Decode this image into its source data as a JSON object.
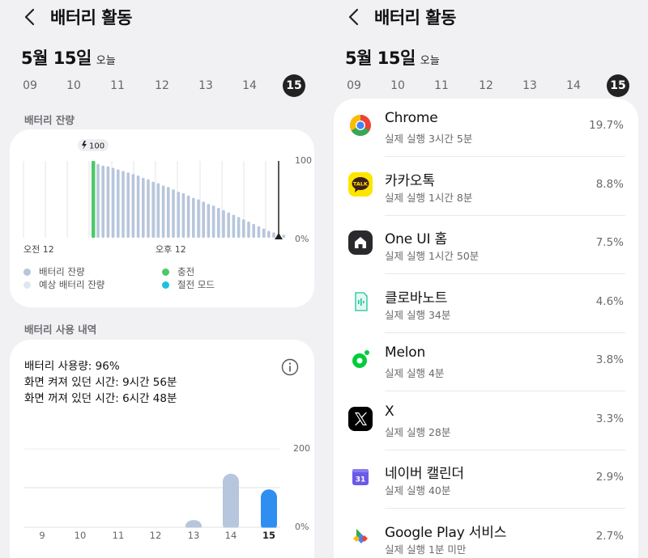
{
  "left": {
    "title": "배터리 활동",
    "date": "5월 15일",
    "date_sub": "오늘",
    "days": [
      "09",
      "10",
      "11",
      "12",
      "13",
      "14",
      "15"
    ],
    "selected_day": "15",
    "remaining_section": "배터리 잔량",
    "remaining_chart": {
      "charge_badge": "100",
      "y_top_label": "100",
      "y_bottom_label": "0%",
      "x_label_start": "오전 12",
      "x_label_mid": "오후 12",
      "levels": [
        100,
        96,
        94,
        93,
        91,
        89,
        87,
        85,
        83,
        81,
        78,
        76,
        73,
        71,
        68,
        66,
        63,
        60,
        58,
        55,
        52,
        50,
        47,
        44,
        42,
        39,
        36,
        33,
        30,
        27,
        24,
        21,
        18,
        15,
        12,
        9,
        7,
        5,
        4
      ],
      "colors": {
        "remaining": "#b7c6dc",
        "charging": "#4ec86a",
        "power_saving": "#1fc0e0",
        "estimated": "#dfe6ef"
      }
    },
    "legend": {
      "remaining": "배터리 잔량",
      "estimated": "예상 배터리 잔량",
      "charging": "충전",
      "power_saving": "절전 모드"
    },
    "usage_section": "배터리 사용 내역",
    "usage": {
      "line1": "배터리 사용량: 96%",
      "line2": "화면 켜져 있던 시간: 9시간 56분",
      "line3": "화면 꺼져 있던 시간: 6시간 48분"
    },
    "usage_chart": {
      "y_top_label": "200",
      "y_bottom_label": "0%",
      "days": [
        "9",
        "10",
        "11",
        "12",
        "13",
        "14",
        "15"
      ],
      "values": [
        0,
        0,
        0,
        0,
        11,
        82,
        58
      ],
      "ymax": 120,
      "colors": {
        "past": "#b7c6dc",
        "today": "#2f8ef0"
      }
    }
  },
  "right": {
    "title": "배터리 활동",
    "date": "5월 15일",
    "date_sub": "오늘",
    "days": [
      "09",
      "10",
      "11",
      "12",
      "13",
      "14",
      "15"
    ],
    "selected_day": "15",
    "apps": [
      {
        "name": "Chrome",
        "detail": "실제 실행 3시간 5분",
        "pct": "19.7%",
        "icon": "chrome-icon"
      },
      {
        "name": "카카오톡",
        "detail": "실제 실행 1시간 8분",
        "pct": "8.8%",
        "icon": "kakaotalk-icon",
        "icon_text": "TALK"
      },
      {
        "name": "One UI 홈",
        "detail": "실제 실행 1시간 50분",
        "pct": "7.5%",
        "icon": "home-icon"
      },
      {
        "name": "클로바노트",
        "detail": "실제 실행 34분",
        "pct": "4.6%",
        "icon": "clova-note-icon"
      },
      {
        "name": "Melon",
        "detail": "실제 실행 4분",
        "pct": "3.8%",
        "icon": "melon-icon"
      },
      {
        "name": "X",
        "detail": "실제 실행 28분",
        "pct": "3.3%",
        "icon": "x-icon"
      },
      {
        "name": "네이버 캘린더",
        "detail": "실제 실행 40분",
        "pct": "2.9%",
        "icon": "calendar-icon",
        "icon_text": "31"
      },
      {
        "name": "Google Play 서비스",
        "detail": "실제 실행 1분 미만",
        "pct": "2.7%",
        "icon": "google-play-services-icon"
      }
    ]
  }
}
